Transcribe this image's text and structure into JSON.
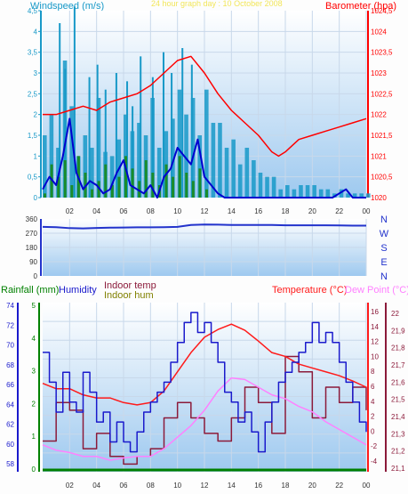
{
  "colors": {
    "bg": "#fdfdfd",
    "plot_top": "#ffffff",
    "plot_bottom": "#9ec9ef",
    "grid": "#c8d8ea",
    "wind": "#1899c8",
    "wind_avg": "#0000d0",
    "gust": "#1a8a1a",
    "baro": "#ff0000",
    "dir": "#2233cc",
    "rain": "#008000",
    "humidity": "#1a1acc",
    "indoor_temp": "#8b1a3a",
    "indoor_hum": "#808000",
    "temperature": "#ff1a1a",
    "dewpoint": "#ff80ff"
  },
  "chart_data": [
    {
      "type": "line",
      "title": "24 hour graph day : 10 October 2008",
      "ylabel_left": "Windspeed (m/s)",
      "ylabel_right": "Barometer (hpa)",
      "left_ticks": [
        "4,5",
        "4",
        "3,5",
        "3",
        "2,5",
        "2",
        "1,5",
        "1",
        "0,5",
        "0"
      ],
      "right_ticks": [
        "1024,5",
        "1024",
        "1023,5",
        "1023",
        "1022,5",
        "1022",
        "1021,5",
        "1021",
        "1020,5",
        "1020"
      ],
      "x_ticks": [
        "02",
        "04",
        "06",
        "08",
        "10",
        "12",
        "14",
        "16",
        "18",
        "20",
        "22",
        "00"
      ],
      "xlim": [
        0,
        24
      ],
      "ylim_left": [
        0,
        4.5
      ],
      "ylim_right": [
        1020,
        1024.5
      ],
      "series": [
        {
          "name": "wind",
          "axis": "left",
          "x": [
            0,
            0.5,
            1,
            1.5,
            2,
            2.5,
            3,
            3.5,
            4,
            4.5,
            5,
            5.5,
            6,
            6.5,
            7,
            7.5,
            8,
            8.5,
            9,
            9.5,
            10,
            10.5,
            11,
            11.5,
            12,
            12.5,
            13,
            13.5,
            14,
            14.5,
            15,
            15.5,
            16,
            16.5,
            17,
            17.5,
            18,
            18.5,
            19,
            19.5,
            20,
            20.5,
            21,
            21.5,
            22,
            22.5,
            23,
            23.5,
            24
          ],
          "y": [
            1.5,
            2.0,
            1.2,
            3.3,
            2.2,
            1.0,
            1.5,
            1.2,
            2.4,
            1.1,
            1.0,
            1.4,
            2.0,
            1.6,
            1.8,
            1.5,
            2.4,
            1.2,
            1.6,
            1.9,
            2.6,
            2.0,
            2.4,
            1.5,
            2.6,
            1.8,
            1.8,
            1.2,
            1.4,
            0.8,
            1.2,
            0.9,
            0.6,
            0.5,
            0.5,
            0.2,
            0.3,
            0.2,
            0.3,
            0.3,
            0.3,
            0.2,
            0.2,
            0.1,
            0.2,
            0.1,
            0.1,
            0.1,
            0.1
          ]
        },
        {
          "name": "gust",
          "axis": "left",
          "x": [
            1.2,
            1.6,
            2.3,
            3.4,
            4.0,
            4.6,
            5.4,
            6.2,
            6.6,
            7.2,
            8.1,
            8.9,
            9.5,
            10.3,
            11.0
          ],
          "y": [
            4.2,
            3.1,
            4.6,
            2.9,
            3.2,
            2.6,
            3.0,
            2.8,
            2.2,
            3.4,
            2.9,
            3.5,
            3.0,
            3.6,
            3.2
          ]
        },
        {
          "name": "wind_avg",
          "axis": "left",
          "x": [
            0,
            0.5,
            1,
            1.5,
            2,
            2.5,
            3,
            3.5,
            4,
            4.5,
            5,
            5.5,
            6,
            6.5,
            7,
            7.5,
            8,
            8.5,
            9,
            9.5,
            10,
            10.5,
            11,
            11.5,
            12,
            12.5,
            13,
            13.5,
            14,
            14.5,
            15,
            15.5,
            16,
            16.5,
            17,
            17.5,
            18,
            18.5,
            19,
            19.5,
            20,
            20.5,
            21,
            21.5,
            22,
            22.5,
            23,
            23.5,
            24
          ],
          "y": [
            0.2,
            0.5,
            0.3,
            1.0,
            1.9,
            0.6,
            0.2,
            0.4,
            0.3,
            0.1,
            0.2,
            0.6,
            0.9,
            0.3,
            0.2,
            0.1,
            0.3,
            0.0,
            0.5,
            0.7,
            1.2,
            1.0,
            0.8,
            1.4,
            0.5,
            0.3,
            0.1,
            0.0,
            0.0,
            0.0,
            0.0,
            0.0,
            0.0,
            0.0,
            0.0,
            0.0,
            0.0,
            0.0,
            0.0,
            0.0,
            0.0,
            0.0,
            0.0,
            0.0,
            0.1,
            0.2,
            0.0,
            0.0,
            0.0
          ]
        },
        {
          "name": "rain_gust",
          "axis": "left",
          "x": [
            0,
            0.5,
            1,
            1.5,
            2,
            2.5,
            3,
            3.5,
            4,
            4.5,
            5,
            5.5,
            6,
            6.5,
            7,
            7.5,
            8,
            8.5,
            9,
            9.5,
            10,
            10.5,
            11,
            11.5,
            12
          ],
          "y": [
            0.1,
            0.8,
            0.5,
            0.9,
            0.3,
            1.0,
            0.6,
            0.2,
            0.4,
            0.8,
            0.3,
            0.5,
            1.0,
            0.7,
            0.4,
            0.9,
            0.6,
            0.3,
            0.8,
            0.5,
            1.0,
            0.6,
            0.4,
            0.7,
            0.2
          ]
        },
        {
          "name": "barometer",
          "axis": "right",
          "x": [
            0,
            1,
            2,
            3,
            4,
            5,
            6,
            7,
            8,
            9,
            10,
            11,
            12,
            13,
            14,
            15,
            16,
            17,
            17.5,
            18,
            19,
            20,
            21,
            22,
            23,
            24
          ],
          "y": [
            1022.0,
            1022.0,
            1022.1,
            1022.2,
            1022.1,
            1022.3,
            1022.4,
            1022.5,
            1022.7,
            1023.0,
            1023.3,
            1023.4,
            1023.0,
            1022.5,
            1022.1,
            1021.8,
            1021.5,
            1021.1,
            1021.0,
            1021.1,
            1021.4,
            1021.5,
            1021.6,
            1021.7,
            1021.8,
            1021.9
          ]
        }
      ]
    },
    {
      "type": "line",
      "left_ticks": [
        "360",
        "270",
        "180",
        "90",
        "0"
      ],
      "right_ticks": [
        "N",
        "W",
        "S",
        "E",
        "N"
      ],
      "ylim": [
        0,
        360
      ],
      "series": [
        {
          "name": "direction",
          "x": [
            0,
            1,
            2,
            3,
            4,
            5,
            6,
            7,
            8,
            9,
            10,
            11,
            12,
            13,
            14,
            15,
            16,
            17,
            18,
            19,
            20,
            21,
            22,
            23,
            24
          ],
          "y": [
            310,
            308,
            302,
            300,
            303,
            305,
            306,
            307,
            307,
            308,
            310,
            322,
            325,
            324,
            322,
            322,
            322,
            322,
            320,
            320,
            320,
            320,
            319,
            318,
            318
          ]
        }
      ]
    },
    {
      "type": "line",
      "legend": [
        "Rainfall (mm)",
        "Humidity",
        "Indoor temp",
        "Indoor hum",
        "Temperature (°C)",
        "Dew Point (°C)"
      ],
      "humidity_ticks": [
        "74",
        "72",
        "70",
        "68",
        "66",
        "64",
        "62",
        "60",
        "58"
      ],
      "rain_ticks": [
        "5",
        "4",
        "3",
        "2",
        "1",
        "0"
      ],
      "temp_ticks": [
        "16",
        "14",
        "12",
        "10",
        "8",
        "6",
        "4",
        "2",
        "0",
        "-2",
        "-4"
      ],
      "indoor_ticks": [
        "22",
        "21,9",
        "21,8",
        "21,7",
        "21,6",
        "21,5",
        "21,4",
        "21,3",
        "21,2",
        "21,1"
      ],
      "x_ticks": [
        "02",
        "04",
        "06",
        "08",
        "10",
        "12",
        "14",
        "16",
        "18",
        "20",
        "22",
        "00"
      ],
      "ylim_humidity": [
        57,
        74
      ],
      "ylim_temp": [
        -5,
        17
      ],
      "series": [
        {
          "name": "Humidity",
          "x": [
            0,
            0.5,
            1,
            1.5,
            2,
            2.5,
            3,
            3.5,
            4,
            4.5,
            5,
            5.5,
            6,
            6.5,
            7,
            7.5,
            8,
            8.5,
            9,
            9.5,
            10,
            10.5,
            11,
            11.5,
            12,
            12.5,
            13,
            13.5,
            14,
            14.5,
            15,
            15.5,
            16,
            16.5,
            17,
            17.5,
            18,
            18.5,
            19,
            19.5,
            20,
            20.5,
            21,
            21.5,
            22,
            22.5,
            23,
            23.5,
            24
          ],
          "y": [
            69,
            66,
            63,
            67,
            64,
            63,
            67,
            65,
            62,
            63,
            60,
            62,
            60,
            59,
            61,
            63,
            64,
            65,
            66,
            68,
            70,
            72,
            73,
            71,
            72,
            70,
            68,
            65,
            64,
            62,
            63,
            61,
            59,
            62,
            64,
            66,
            67,
            68,
            69,
            70,
            72,
            70,
            71,
            70,
            68,
            66,
            64,
            62,
            61
          ]
        },
        {
          "name": "Temperature",
          "x": [
            0,
            1,
            2,
            3,
            4,
            5,
            6,
            7,
            8,
            9,
            10,
            11,
            12,
            13,
            14,
            15,
            16,
            17,
            18,
            19,
            20,
            21,
            22,
            23,
            24
          ],
          "y": [
            6.5,
            5.8,
            5.8,
            5.0,
            4.6,
            4.6,
            4.0,
            3.7,
            4.0,
            5.5,
            8.0,
            10.5,
            12.5,
            13.5,
            14.2,
            13.4,
            12.0,
            10.5,
            10.0,
            9.0,
            8.5,
            8.0,
            7.5,
            6.8,
            6.0
          ]
        },
        {
          "name": "Dew Point",
          "x": [
            0,
            1,
            2,
            3,
            4,
            5,
            6,
            7,
            8,
            9,
            10,
            11,
            12,
            13,
            14,
            15,
            16,
            17,
            18,
            19,
            20,
            21,
            22,
            23,
            24
          ],
          "y": [
            -1.5,
            -2.2,
            -2.5,
            -3.0,
            -3.0,
            -3.5,
            -3.2,
            -3.0,
            -3.0,
            -2.0,
            -0.5,
            1.0,
            3.0,
            5.5,
            7.2,
            7.0,
            6.0,
            5.0,
            4.5,
            3.5,
            2.8,
            1.5,
            0.5,
            -0.5,
            -1.5
          ]
        },
        {
          "name": "Indoor temp",
          "x": [
            0,
            1,
            2,
            3,
            4,
            5,
            6,
            7,
            8,
            9,
            10,
            11,
            12,
            13,
            14,
            15,
            16,
            17,
            18,
            19,
            20,
            21,
            22,
            23,
            24
          ],
          "y": [
            -1,
            4,
            3,
            -2,
            0,
            -3,
            -4,
            -3,
            -2,
            2,
            4,
            2,
            0,
            -1,
            2,
            6,
            4,
            0,
            10,
            8,
            2,
            6,
            4,
            6,
            3
          ]
        },
        {
          "name": "Rainfall",
          "x": [
            0,
            24
          ],
          "y": [
            0,
            0
          ]
        }
      ]
    }
  ],
  "labels": {
    "title": "24 hour graph day : 10 October 2008",
    "windspeed": "Windspeed (m/s)",
    "barometer": "Barometer (hpa)",
    "rainfall": "Rainfall (mm)",
    "humidity": "Humidity",
    "indoor_temp": "Indoor temp",
    "indoor_hum": "Indoor hum",
    "temperature": "Temperature (°C)",
    "dewpoint": "Dew Point (°C)"
  }
}
